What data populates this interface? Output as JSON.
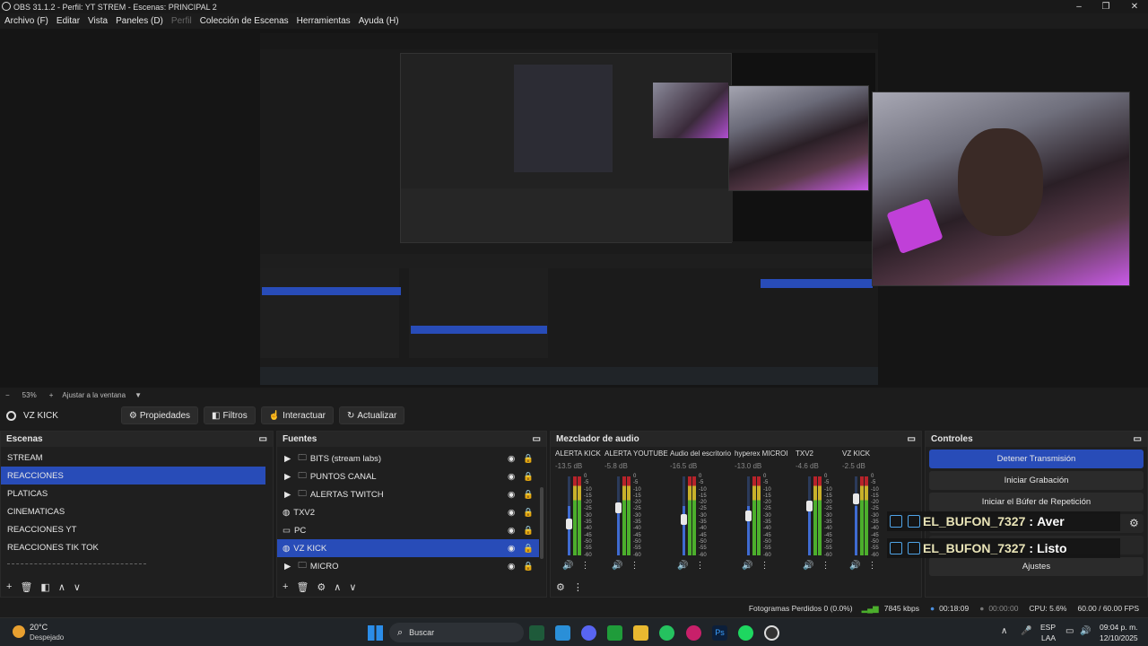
{
  "window": {
    "title": "OBS 31.1.2 - Perfil: YT STREM - Escenas: PRINCIPAL 2"
  },
  "menu": [
    "Archivo (F)",
    "Editar",
    "Vista",
    "Paneles (D)",
    "Perfil",
    "Colección de Escenas",
    "Herramientas",
    "Ayuda (H)"
  ],
  "zoom": {
    "level": "53%",
    "fit": "Ajustar a la ventana"
  },
  "source_bar": {
    "current": "VZ  KICK",
    "properties": "Propiedades",
    "filters": "Filtros",
    "interact": "Interactuar",
    "refresh": "Actualizar"
  },
  "scenes": {
    "title": "Escenas",
    "items": [
      "STREAM",
      "REACCIONES",
      "PLATICAS",
      "CINEMATICAS",
      "REACCIONES YT",
      "REACCIONES TIK TOK"
    ],
    "selected": 1
  },
  "sources": {
    "title": "Fuentes",
    "items": [
      {
        "name": "BITS (stream labs)",
        "type": "folder"
      },
      {
        "name": "PUNTOS CANAL",
        "type": "folder"
      },
      {
        "name": "ALERTAS TWITCH",
        "type": "folder"
      },
      {
        "name": "TXV2",
        "type": "browser"
      },
      {
        "name": "PC",
        "type": "display"
      },
      {
        "name": "VZ  KICK",
        "type": "browser"
      },
      {
        "name": "MICRO",
        "type": "folder"
      }
    ],
    "selected": 5
  },
  "mixer": {
    "title": "Mezclador de audio",
    "channels": [
      {
        "name": "ALERTA KICK",
        "db": "-13.5 dB",
        "fader": 0.38
      },
      {
        "name": "ALERTA YOUTUBE",
        "db": "-5.8 dB",
        "fader": 0.62
      },
      {
        "name": "Audio del escritorio",
        "db": "-16.5 dB",
        "fader": 0.45
      },
      {
        "name": "hyperex MICROI",
        "db": "-13.0 dB",
        "fader": 0.5
      },
      {
        "name": "TXV2",
        "db": "-4.6 dB",
        "fader": 0.65
      },
      {
        "name": "VZ  KICK",
        "db": "-2.5 dB",
        "fader": 0.75
      }
    ],
    "scale": [
      "0",
      "-5",
      "-10",
      "-15",
      "-20",
      "-25",
      "-30",
      "-35",
      "-40",
      "-45",
      "-50",
      "-55",
      "-60"
    ]
  },
  "controls": {
    "title": "Controles",
    "stop_stream": "Detener Transmisión",
    "start_rec": "Iniciar Grabación",
    "replay": "Iniciar el Búfer de Repetición",
    "settings": "Ajustes"
  },
  "chat": [
    {
      "user": "EL_BUFON_7327",
      "msg": "Aver"
    },
    {
      "user": "EL_BUFON_7327",
      "msg": "Listo"
    }
  ],
  "status": {
    "dropped": "Fotogramas Perdidos 0 (0.0%)",
    "bitrate": "7845 kbps",
    "stream_time": "00:18:09",
    "rec_time": "00:00:00",
    "cpu": "CPU: 5.6%",
    "fps": "60.00 / 60.00 FPS"
  },
  "taskbar": {
    "weather_temp": "20°C",
    "weather_desc": "Despejado",
    "search": "Buscar",
    "lang": "ESP",
    "lang2": "LAA",
    "time": "09:04 p. m.",
    "date": "12/10/2025"
  },
  "colors": {
    "accent": "#284cb8",
    "meter_green": "#4caf2c",
    "meter_yellow": "#c8b12a",
    "meter_red": "#b8232a"
  }
}
